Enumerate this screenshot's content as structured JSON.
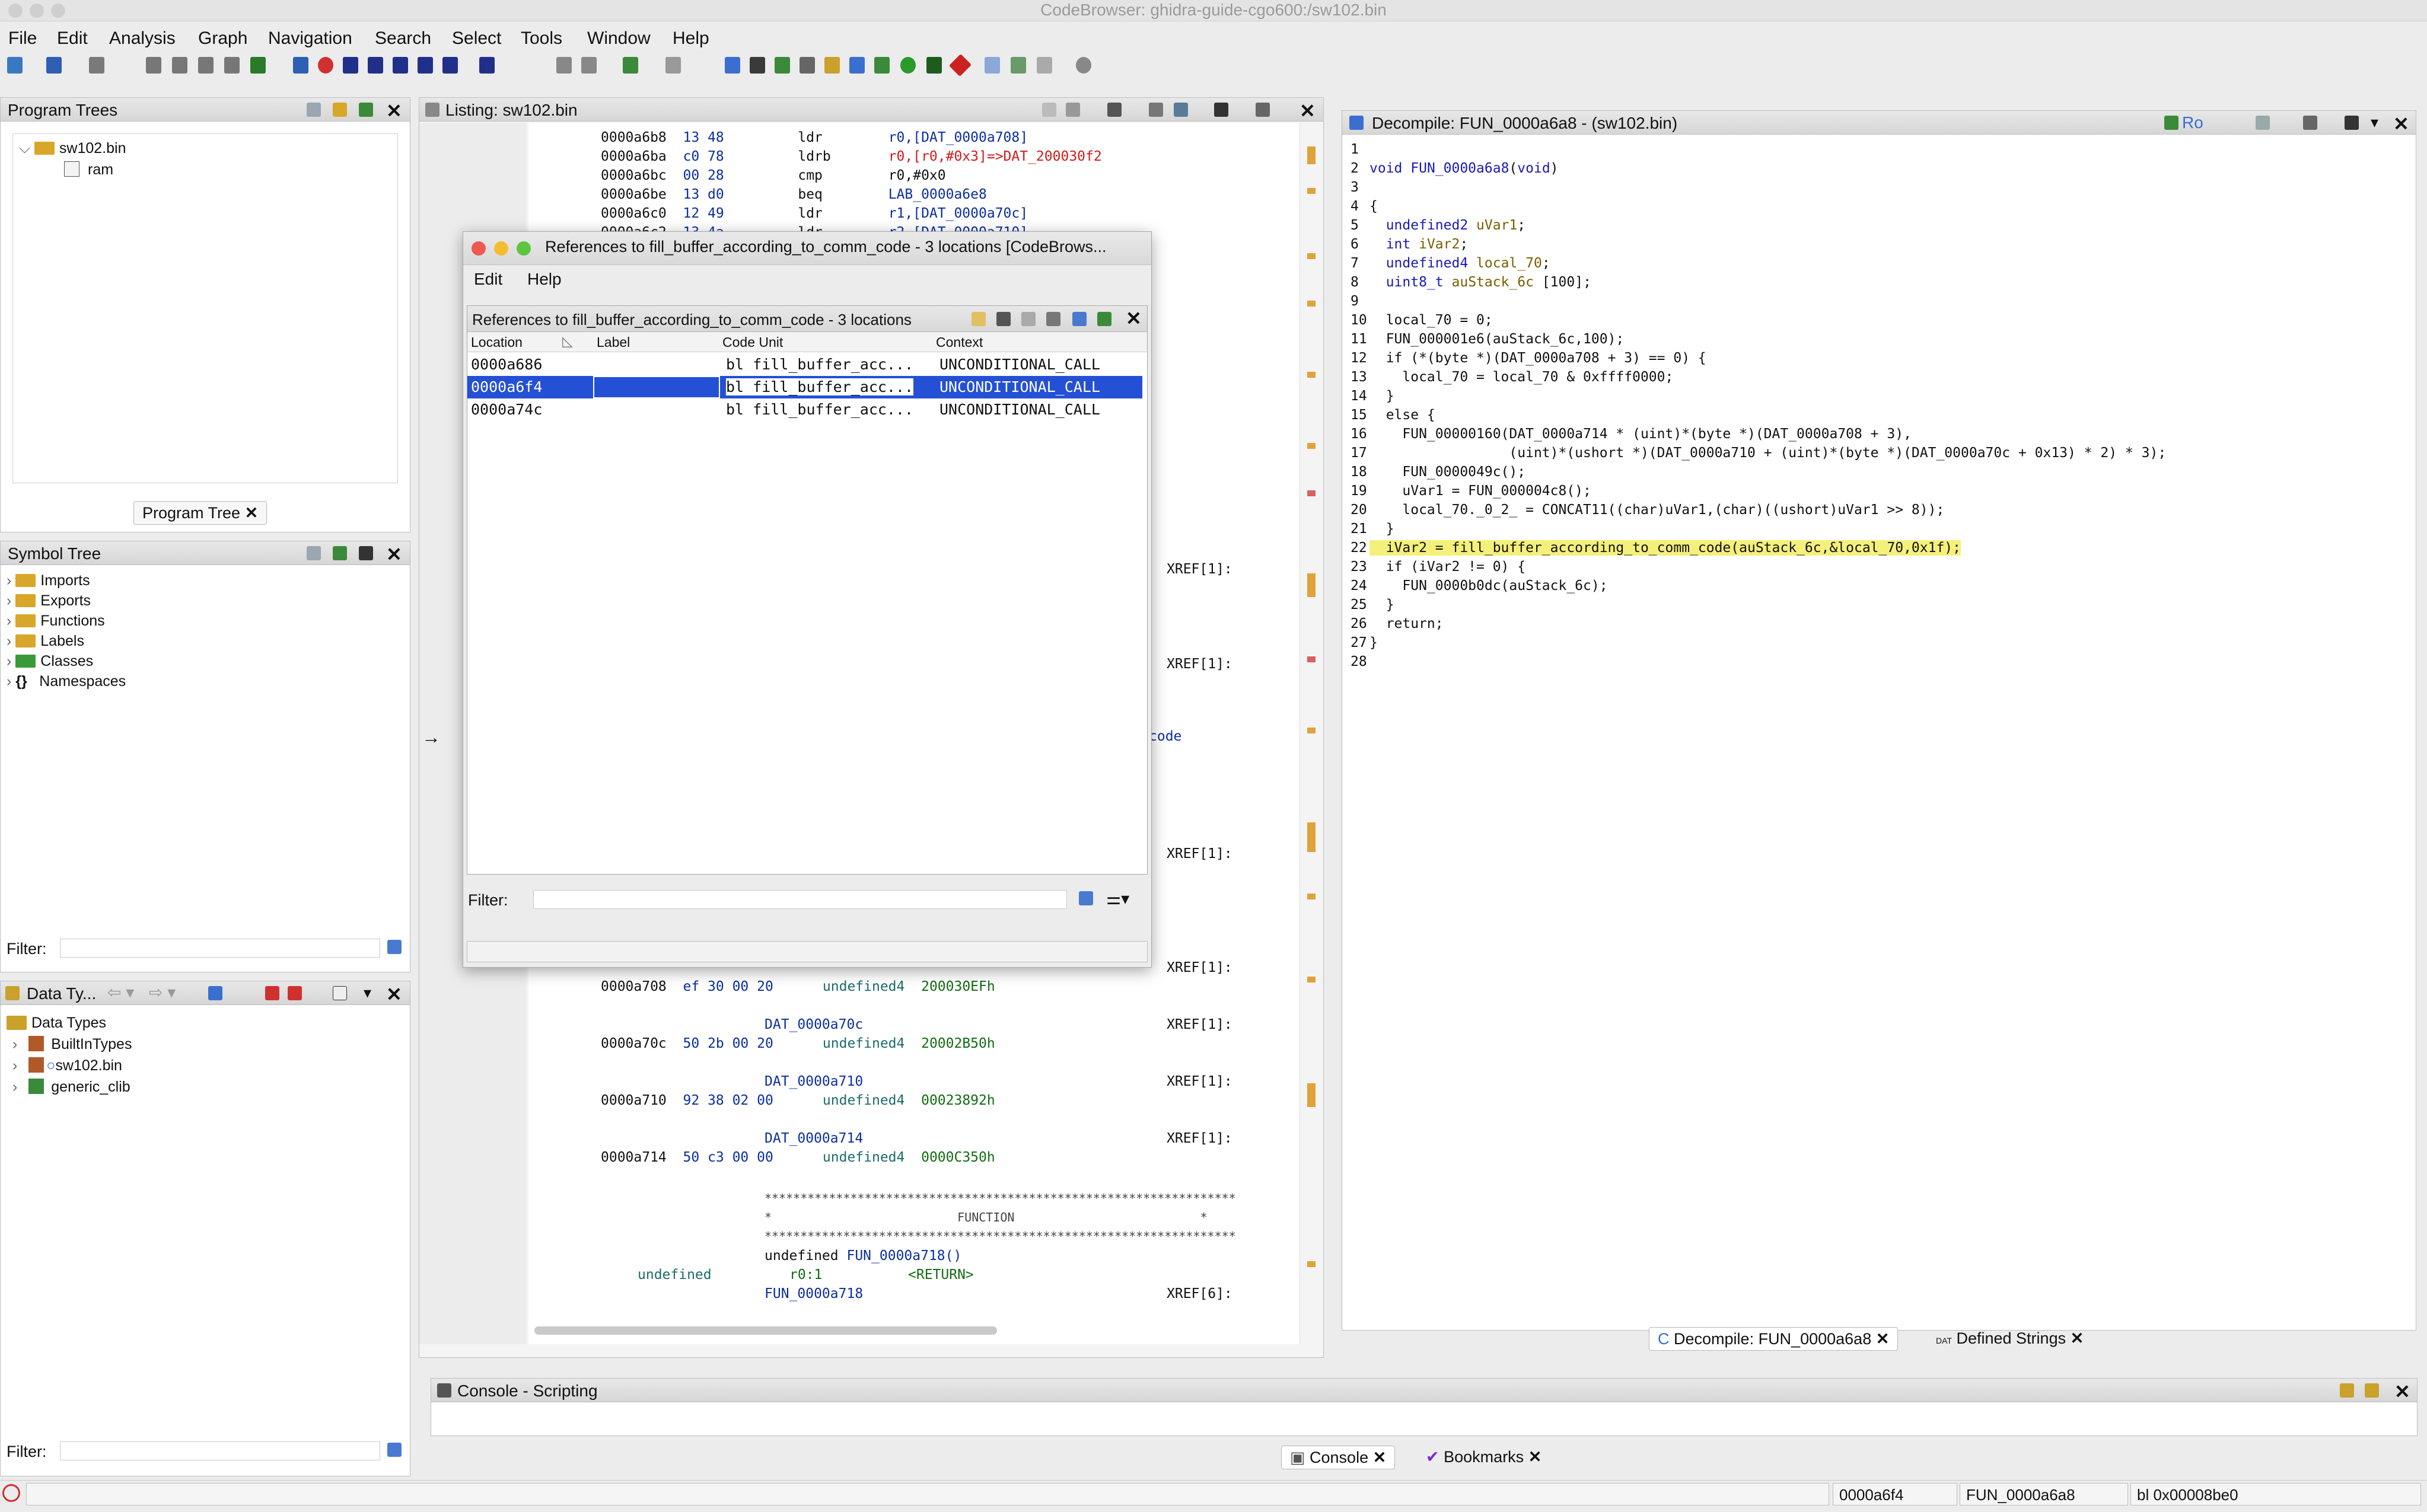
{
  "window": {
    "title": "CodeBrowser: ghidra-guide-cgo600:/sw102.bin"
  },
  "menu": [
    "File",
    "Edit",
    "Analysis",
    "Graph",
    "Navigation",
    "Search",
    "Select",
    "Tools",
    "Window",
    "Help"
  ],
  "program_trees": {
    "title": "Program Trees",
    "root": "sw102.bin",
    "child": "ram",
    "tab": "Program Tree"
  },
  "symbol_tree": {
    "title": "Symbol Tree",
    "items": [
      "Imports",
      "Exports",
      "Functions",
      "Labels",
      "Classes",
      "Namespaces"
    ],
    "filter_label": "Filter:"
  },
  "data_types": {
    "title": "Data Ty...",
    "root": "Data Types",
    "items": [
      "BuiltInTypes",
      "sw102.bin",
      "generic_clib"
    ],
    "filter_label": "Filter:"
  },
  "listing": {
    "title": "Listing:  sw102.bin",
    "lines": [
      {
        "addr": "0000a6b8",
        "bytes": "13 48",
        "mn": "ldr",
        "op": "r0,[DAT_0000a708]"
      },
      {
        "addr": "0000a6ba",
        "bytes": "c0 78",
        "mn": "ldrb",
        "op": "r0,[r0,#0x3]=>DAT_200030f2"
      },
      {
        "addr": "0000a6bc",
        "bytes": "00 28",
        "mn": "cmp",
        "op": "r0,#0x0"
      },
      {
        "addr": "0000a6be",
        "bytes": "13 d0",
        "mn": "beq",
        "op": "LAB_0000a6e8"
      },
      {
        "addr": "0000a6c0",
        "bytes": "12 49",
        "mn": "ldr",
        "op": "r1,[DAT_0000a70c]"
      },
      {
        "addr": "0000a6c2",
        "bytes": "13 4a",
        "mn": "ldr",
        "op": "r2,[DAT_0000a710]"
      }
    ],
    "xref1": "XREF[1]:",
    "xref6": "XREF[6]:",
    "frag_code": "code",
    "data_lines": [
      {
        "label": "DAT_0000a708",
        "addr": "0000a708",
        "bytes": "ef 30 00 20",
        "type": "undefined4",
        "val": "200030EFh"
      },
      {
        "label": "DAT_0000a70c",
        "addr": "0000a70c",
        "bytes": "50 2b 00 20",
        "type": "undefined4",
        "val": "20002B50h"
      },
      {
        "label": "DAT_0000a710",
        "addr": "0000a710",
        "bytes": "92 38 02 00",
        "type": "undefined4",
        "val": "00023892h"
      },
      {
        "label": "DAT_0000a714",
        "addr": "0000a714",
        "bytes": "50 c3 00 00",
        "type": "undefined4",
        "val": "0000C350h"
      }
    ],
    "stars": "******************************************************************",
    "function_banner": "*                          FUNCTION                          *",
    "func_sig_prefix": "undefined ",
    "func_sig_name": "FUN_0000a718()",
    "ret_type": "undefined",
    "ret_reg": "r0:1",
    "ret_tag": "<RETURN>",
    "func_label": "FUN_0000a718"
  },
  "references_dialog": {
    "title": "References to fill_buffer_according_to_comm_code - 3 locations [CodeBrows...",
    "menu": [
      "Edit",
      "Help"
    ],
    "inner_title": "References to fill_buffer_according_to_comm_code - 3 locations",
    "columns": [
      "Location",
      "Label",
      "Code Unit",
      "Context"
    ],
    "rows": [
      {
        "location": "0000a686",
        "label": "",
        "code_unit": "bl fill_buffer_acc...",
        "context": "UNCONDITIONAL_CALL"
      },
      {
        "location": "0000a6f4",
        "label": "",
        "code_unit": "bl fill_buffer_acc...",
        "context": "UNCONDITIONAL_CALL"
      },
      {
        "location": "0000a74c",
        "label": "",
        "code_unit": "bl fill_buffer_acc...",
        "context": "UNCONDITIONAL_CALL"
      }
    ],
    "selected_row": 1,
    "filter_label": "Filter:"
  },
  "decompile": {
    "title": "Decompile: FUN_0000a6a8 -  (sw102.bin)",
    "ro": "Ro",
    "lines": [
      "",
      "void FUN_0000a6a8(void)",
      "",
      "{",
      "  undefined2 uVar1;",
      "  int iVar2;",
      "  undefined4 local_70;",
      "  uint8_t auStack_6c [100];",
      "",
      "  local_70 = 0;",
      "  FUN_000001e6(auStack_6c,100);",
      "  if (*(byte *)(DAT_0000a708 + 3) == 0) {",
      "    local_70 = local_70 & 0xffff0000;",
      "  }",
      "  else {",
      "    FUN_00000160(DAT_0000a714 * (uint)*(byte *)(DAT_0000a708 + 3),",
      "                 (uint)*(ushort *)(DAT_0000a710 + (uint)*(byte *)(DAT_0000a70c + 0x13) * 2) * 3);",
      "    FUN_0000049c();",
      "    uVar1 = FUN_000004c8();",
      "    local_70._0_2_ = CONCAT11((char)uVar1,(char)((ushort)uVar1 >> 8));",
      "  }",
      "  iVar2 = fill_buffer_according_to_comm_code(auStack_6c,&local_70,0x1f);",
      "  if (iVar2 != 0) {",
      "    FUN_0000b0dc(auStack_6c);",
      "  }",
      "  return;",
      "}",
      ""
    ],
    "tabs": [
      "Decompile: FUN_0000a6a8",
      "Defined Strings"
    ]
  },
  "console": {
    "title": "Console - Scripting",
    "tabs": [
      "Console",
      "Bookmarks"
    ]
  },
  "status": {
    "address": "0000a6f4",
    "function": "FUN_0000a6a8",
    "instruction": "bl 0x00008be0"
  }
}
